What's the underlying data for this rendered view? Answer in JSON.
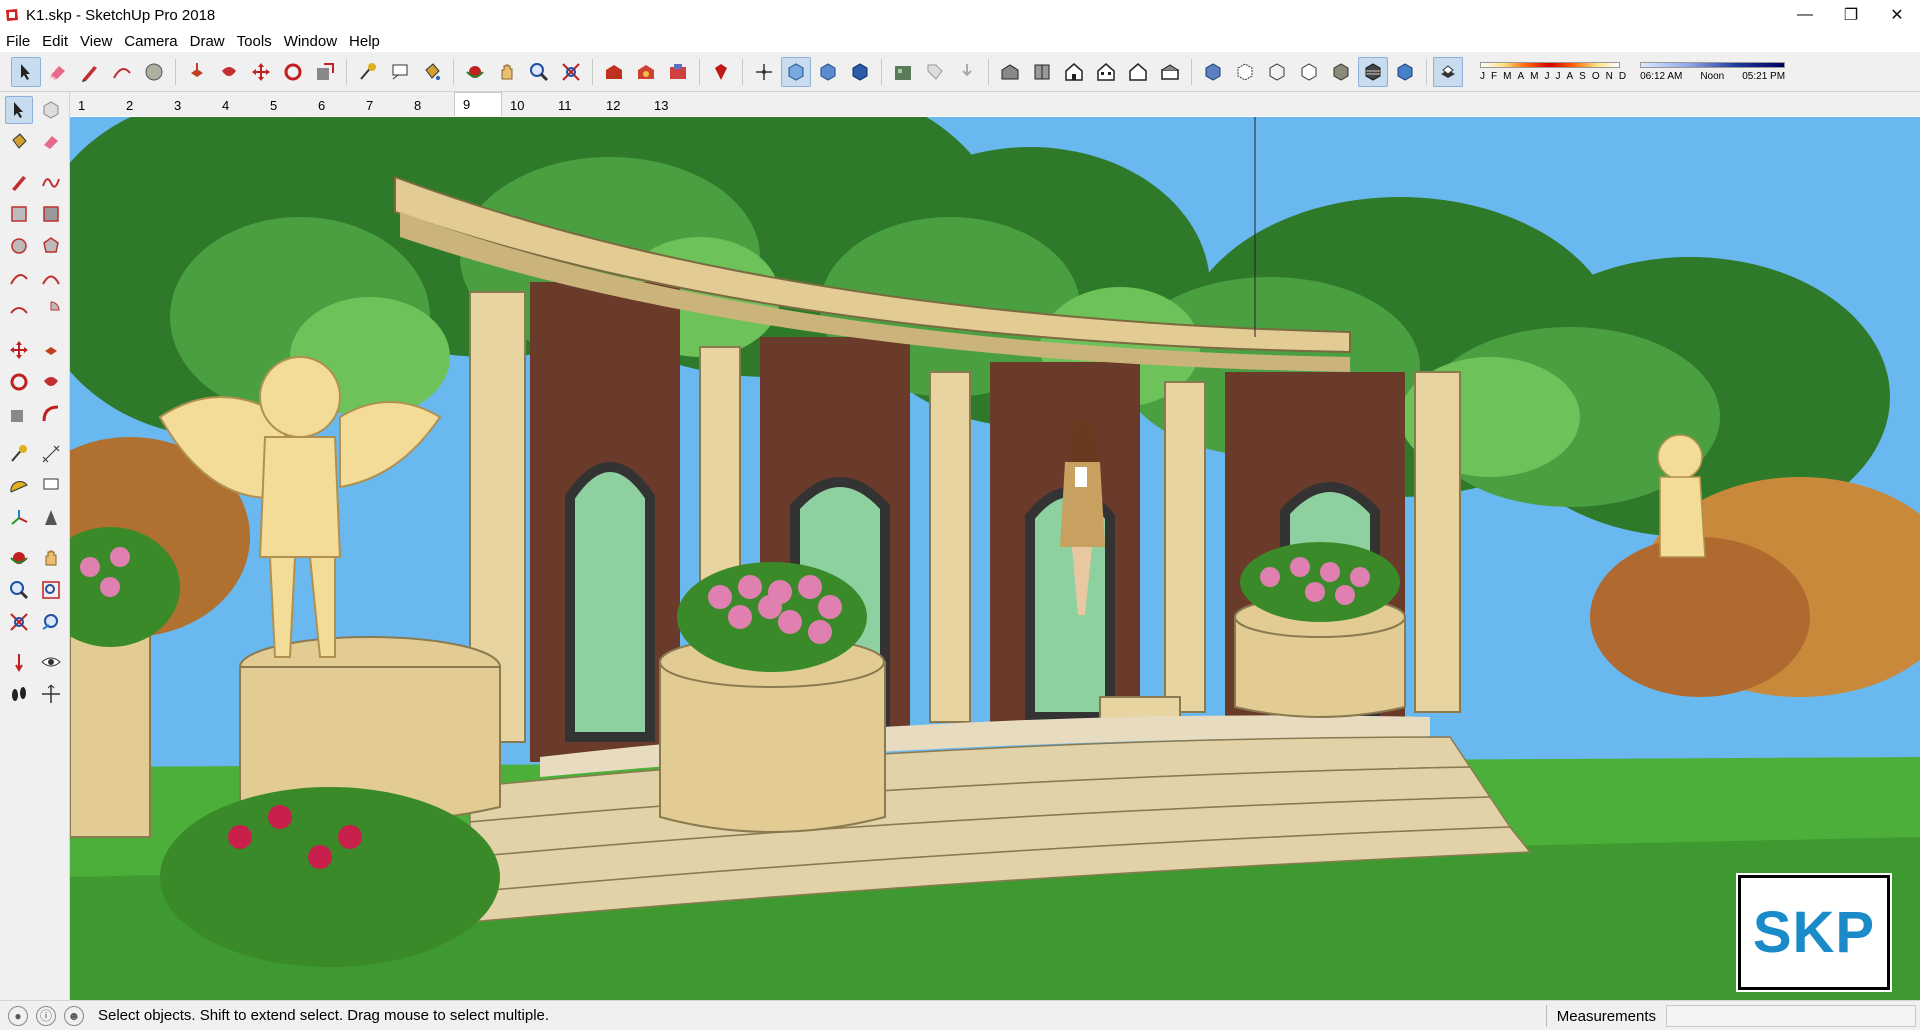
{
  "window": {
    "title": "K1.skp - SketchUp Pro 2018",
    "app_icon": "sketchup-logo-icon",
    "controls": [
      "minimize-icon",
      "restore-icon",
      "close-icon"
    ]
  },
  "menu": {
    "items": [
      "File",
      "Edit",
      "View",
      "Camera",
      "Draw",
      "Tools",
      "Window",
      "Help"
    ]
  },
  "shadows": {
    "month_letters": [
      "J",
      "F",
      "M",
      "A",
      "M",
      "J",
      "J",
      "A",
      "S",
      "O",
      "N",
      "D"
    ],
    "time_start": "06:12 AM",
    "time_mid": "Noon",
    "time_end": "05:21 PM"
  },
  "scene_tabs": {
    "items": [
      "1",
      "2",
      "3",
      "4",
      "5",
      "6",
      "7",
      "8",
      "9",
      "10",
      "11",
      "12",
      "13"
    ],
    "active": "9"
  },
  "viewport": {
    "logo_text": "SKP",
    "sky_color": "#6ab8f0",
    "grass_color": "#4caf3a"
  },
  "status": {
    "message": "Select objects. Shift to extend select. Drag mouse to select multiple.",
    "measurements_label": "Measurements",
    "measurements_value": ""
  }
}
